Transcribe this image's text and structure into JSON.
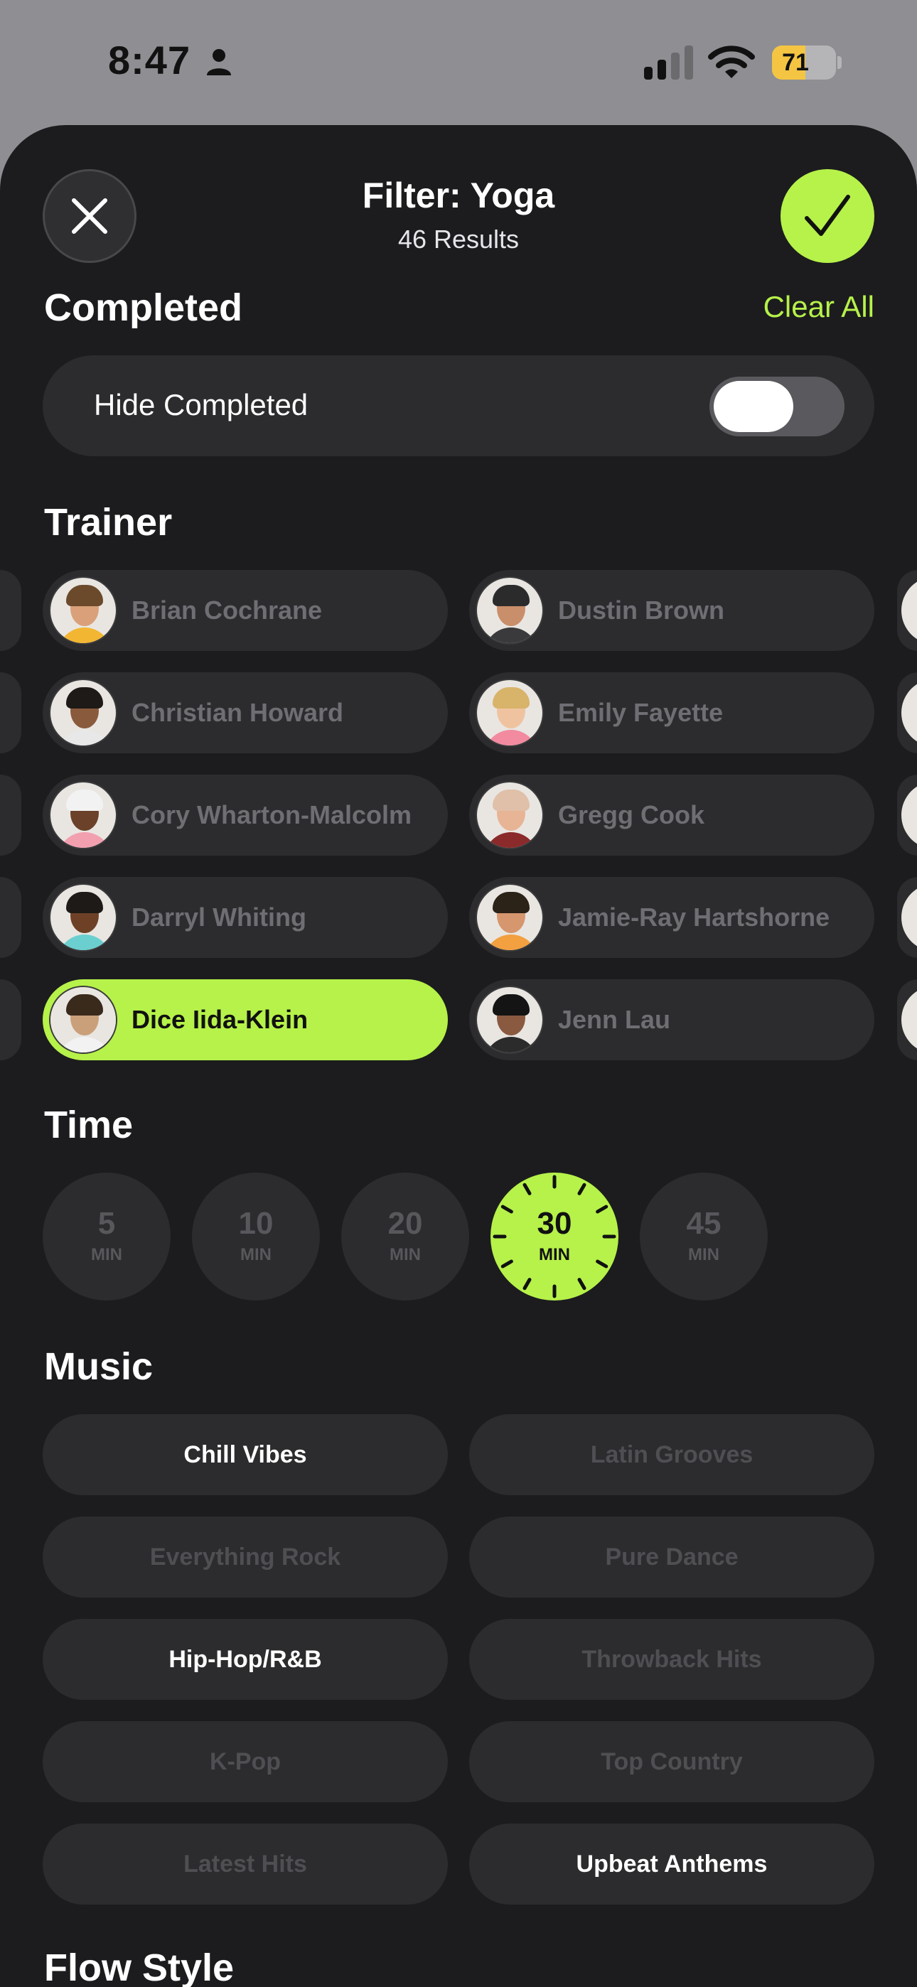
{
  "status_bar": {
    "time": "8:47",
    "battery_percent": "71",
    "battery_level": 0.71,
    "battery_color": "#f4c542"
  },
  "header": {
    "title": "Filter: Yoga",
    "subtitle": "46 Results",
    "close_icon": "close-icon",
    "done_icon": "checkmark-icon"
  },
  "completed": {
    "title": "Completed",
    "clear_all": "Clear All",
    "hide_label": "Hide Completed",
    "hide_enabled": false
  },
  "trainer": {
    "title": "Trainer",
    "items": [
      {
        "name": "Brian Cochrane",
        "selected": false
      },
      {
        "name": "Dustin Brown",
        "selected": false
      },
      {
        "name": "Christian Howard",
        "selected": false
      },
      {
        "name": "Emily Fayette",
        "selected": false
      },
      {
        "name": "Cory Wharton-Malcolm",
        "selected": false
      },
      {
        "name": "Gregg Cook",
        "selected": false
      },
      {
        "name": "Darryl Whiting",
        "selected": false
      },
      {
        "name": "Jamie-Ray Hartshorne",
        "selected": false
      },
      {
        "name": "Dice Iida-Klein",
        "selected": true
      },
      {
        "name": "Jenn Lau",
        "selected": false
      }
    ]
  },
  "time": {
    "title": "Time",
    "options": [
      {
        "value": "5",
        "unit": "MIN",
        "selected": false
      },
      {
        "value": "10",
        "unit": "MIN",
        "selected": false
      },
      {
        "value": "20",
        "unit": "MIN",
        "selected": false
      },
      {
        "value": "30",
        "unit": "MIN",
        "selected": true
      },
      {
        "value": "45",
        "unit": "MIN",
        "selected": false
      }
    ]
  },
  "music": {
    "title": "Music",
    "items": [
      {
        "label": "Chill Vibes",
        "selected": true
      },
      {
        "label": "Latin Grooves",
        "selected": false
      },
      {
        "label": "Everything Rock",
        "selected": false
      },
      {
        "label": "Pure Dance",
        "selected": false
      },
      {
        "label": "Hip-Hop/R&B",
        "selected": true
      },
      {
        "label": "Throwback Hits",
        "selected": false
      },
      {
        "label": "K-Pop",
        "selected": false
      },
      {
        "label": "Top Country",
        "selected": false
      },
      {
        "label": "Latest Hits",
        "selected": false
      },
      {
        "label": "Upbeat Anthems",
        "selected": true
      }
    ]
  },
  "flow_style": {
    "title": "Flow Style"
  },
  "colors": {
    "accent": "#b6f24a",
    "sheet_background": "#1c1c1e",
    "pill_background": "#2c2c2e"
  }
}
